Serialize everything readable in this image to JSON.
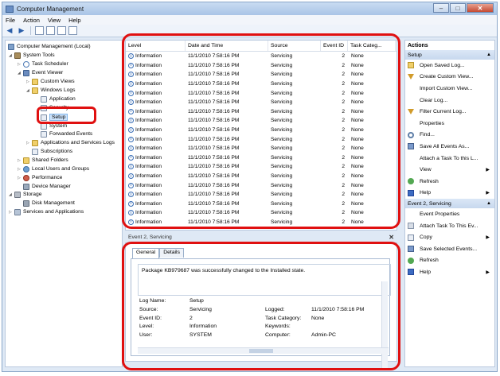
{
  "window": {
    "title": "Computer Management",
    "min": "–",
    "max": "□",
    "close": "✕"
  },
  "menu": [
    "File",
    "Action",
    "View",
    "Help"
  ],
  "tree": {
    "root": "Computer Management (Local)",
    "system_tools": "System Tools",
    "task_scheduler": "Task Scheduler",
    "event_viewer": "Event Viewer",
    "custom_views": "Custom Views",
    "windows_logs": "Windows Logs",
    "application": "Application",
    "security": "Security",
    "setup": "Setup",
    "system": "System",
    "forwarded": "Forwarded Events",
    "apps_services": "Applications and Services Logs",
    "subscriptions": "Subscriptions",
    "shared_folders": "Shared Folders",
    "local_users": "Local Users and Groups",
    "performance": "Performance",
    "device_manager": "Device Manager",
    "storage": "Storage",
    "disk_management": "Disk Management",
    "services_apps": "Services and Applications"
  },
  "list": {
    "columns": [
      "Level",
      "Date and Time",
      "Source",
      "Event ID",
      "Task Categ..."
    ],
    "rows": [
      [
        "Information",
        "11/1/2010 7:58:16 PM",
        "Servicing",
        "2",
        "None"
      ],
      [
        "Information",
        "11/1/2010 7:58:16 PM",
        "Servicing",
        "2",
        "None"
      ],
      [
        "Information",
        "11/1/2010 7:58:16 PM",
        "Servicing",
        "2",
        "None"
      ],
      [
        "Information",
        "11/1/2010 7:58:16 PM",
        "Servicing",
        "2",
        "None"
      ],
      [
        "Information",
        "11/1/2010 7:58:16 PM",
        "Servicing",
        "2",
        "None"
      ],
      [
        "Information",
        "11/1/2010 7:58:16 PM",
        "Servicing",
        "2",
        "None"
      ],
      [
        "Information",
        "11/1/2010 7:58:16 PM",
        "Servicing",
        "2",
        "None"
      ],
      [
        "Information",
        "11/1/2010 7:58:16 PM",
        "Servicing",
        "2",
        "None"
      ],
      [
        "Information",
        "11/1/2010 7:58:16 PM",
        "Servicing",
        "2",
        "None"
      ],
      [
        "Information",
        "11/1/2010 7:58:16 PM",
        "Servicing",
        "2",
        "None"
      ],
      [
        "Information",
        "11/1/2010 7:58:16 PM",
        "Servicing",
        "2",
        "None"
      ],
      [
        "Information",
        "11/1/2010 7:58:16 PM",
        "Servicing",
        "2",
        "None"
      ],
      [
        "Information",
        "11/1/2010 7:58:16 PM",
        "Servicing",
        "2",
        "None"
      ],
      [
        "Information",
        "11/1/2010 7:58:16 PM",
        "Servicing",
        "2",
        "None"
      ],
      [
        "Information",
        "11/1/2010 7:58:16 PM",
        "Servicing",
        "2",
        "None"
      ],
      [
        "Information",
        "11/1/2010 7:58:16 PM",
        "Servicing",
        "2",
        "None"
      ],
      [
        "Information",
        "11/1/2010 7:58:16 PM",
        "Servicing",
        "2",
        "None"
      ],
      [
        "Information",
        "11/1/2010 7:58:16 PM",
        "Servicing",
        "2",
        "None"
      ],
      [
        "Information",
        "11/1/2010 7:58:16 PM",
        "Servicing",
        "2",
        "None"
      ]
    ]
  },
  "detail": {
    "header": "Event 2, Servicing",
    "close": "✕",
    "tabs": [
      "General",
      "Details"
    ],
    "message": "Package KB979687 was successfully changed to the Installed state.",
    "log_name_label": "Log Name:",
    "log_name": "Setup",
    "source_label": "Source:",
    "source": "Servicing",
    "logged_label": "Logged:",
    "logged": "11/1/2010 7:58:16 PM",
    "event_id_label": "Event ID:",
    "event_id": "2",
    "task_cat_label": "Task Category:",
    "task_cat": "None",
    "level_label": "Level:",
    "level": "Information",
    "keywords_label": "Keywords:",
    "keywords": "",
    "user_label": "User:",
    "user": "SYSTEM",
    "computer_label": "Computer:",
    "computer": "Admin-PC"
  },
  "actions": {
    "title": "Actions",
    "group1": "Setup",
    "group1_items": [
      "Open Saved Log...",
      "Create Custom View...",
      "Import Custom View...",
      "Clear Log...",
      "Filter Current Log...",
      "Properties",
      "Find...",
      "Save All Events As...",
      "Attach a Task To this L...",
      "View",
      "Refresh",
      "Help"
    ],
    "group1_icons": [
      "open-icon",
      "filter-icon",
      "blank",
      "blank",
      "filter-icon",
      "properties-icon",
      "find-icon",
      "save-icon",
      "blank",
      "blank",
      "refresh-icon",
      "help-icon"
    ],
    "group2": "Event 2, Servicing",
    "group2_items": [
      "Event Properties",
      "Attach Task To This Ev...",
      "Copy",
      "Save Selected Events...",
      "Refresh",
      "Help"
    ],
    "group2_icons": [
      "properties-icon",
      "attach-icon",
      "copy-icon",
      "save-icon",
      "refresh-icon",
      "help-icon"
    ]
  },
  "colors": {
    "highlight": "#e01010",
    "selection": "#cde3fb",
    "pane_border": "#b9c9de"
  }
}
